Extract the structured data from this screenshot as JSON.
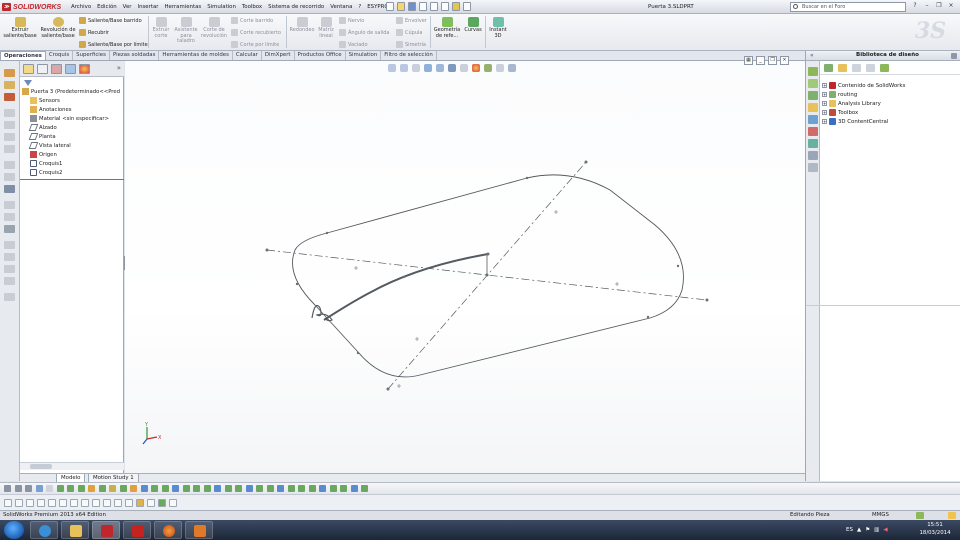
{
  "app": {
    "brand": "SOLIDWORKS",
    "document_title": "Puerta 3.SLDPRT",
    "search_placeholder": "Buscar en el Foro"
  },
  "menu": [
    "Archivo",
    "Edición",
    "Ver",
    "Insertar",
    "Herramientas",
    "Simulation",
    "Toolbox",
    "Sistema de recorrido",
    "Ventana",
    "?",
    "ESYPRO"
  ],
  "ribbon": {
    "extrude_boss": "Extruir saliente/base",
    "revolve_boss": "Revolución de saliente/base",
    "swept_boss": "Saliente/Base barrido",
    "loft": "Recubrir",
    "boundary_boss": "Saliente/Base por límite",
    "extrude_cut": "Extruir corte",
    "hole_wizard": "Asistente para taladro",
    "revolve_cut": "Corte de revolución",
    "swept_cut": "Corte barrido",
    "lofted_cut": "Corte recubierto",
    "boundary_cut": "Corte por límite",
    "fillet": "Redondeo",
    "linear_pattern": "Matriz lineal",
    "rib": "Nervio",
    "draft": "Ángulo de salida",
    "shell": "Vaciado",
    "wrap": "Envolver",
    "dome": "Cúpula",
    "mirror": "Simetría",
    "ref_geometry": "Geometría de refe...",
    "curves": "Curvas",
    "instant3d": "Instant 3D"
  },
  "tabs": [
    "Operaciones",
    "Croquis",
    "Superficies",
    "Piezas soldadas",
    "Herramientas de moldes",
    "Calcular",
    "DimXpert",
    "Productos Office",
    "Simulation",
    "Filtro de selección"
  ],
  "feature_tree": [
    {
      "label": "Puerta 3  (Predeterminado<<Pred",
      "icon": "part-icon",
      "indent": 0
    },
    {
      "label": "Sensors",
      "icon": "sensors-icon",
      "indent": 1
    },
    {
      "label": "Anotaciones",
      "icon": "annotations-icon",
      "indent": 1
    },
    {
      "label": "Material <sin especificar>",
      "icon": "material-icon",
      "indent": 1
    },
    {
      "label": "Alzado",
      "icon": "plane-icon",
      "indent": 1
    },
    {
      "label": "Planta",
      "icon": "plane-icon",
      "indent": 1
    },
    {
      "label": "Vista lateral",
      "icon": "plane-icon",
      "indent": 1
    },
    {
      "label": "Origen",
      "icon": "origin-icon",
      "indent": 1
    },
    {
      "label": "Croquis1",
      "icon": "sketch-icon",
      "indent": 1
    },
    {
      "label": "Croquis2",
      "icon": "sketch-icon",
      "indent": 1
    }
  ],
  "bottom_tabs": [
    "Modelo",
    "Motion Study 1"
  ],
  "status": {
    "edition": "SolidWorks Premium 2013 x64 Edition",
    "mode": "Editando Pieza",
    "units": "MMGS"
  },
  "design_library": {
    "title": "Biblioteca de diseño",
    "items": [
      "Contenido de SolidWorks",
      "routing",
      "Analysis Library",
      "Toolbox",
      "3D ContentCentral"
    ]
  },
  "taskbar": {
    "language": "ES",
    "time": "15:51",
    "date": "18/03/2014"
  },
  "colors": {
    "brand_red": "#c0272d",
    "sketch_line": "#555a60",
    "ribbon_bg": "#eef0f4",
    "taskbar_bg": "#243049"
  }
}
